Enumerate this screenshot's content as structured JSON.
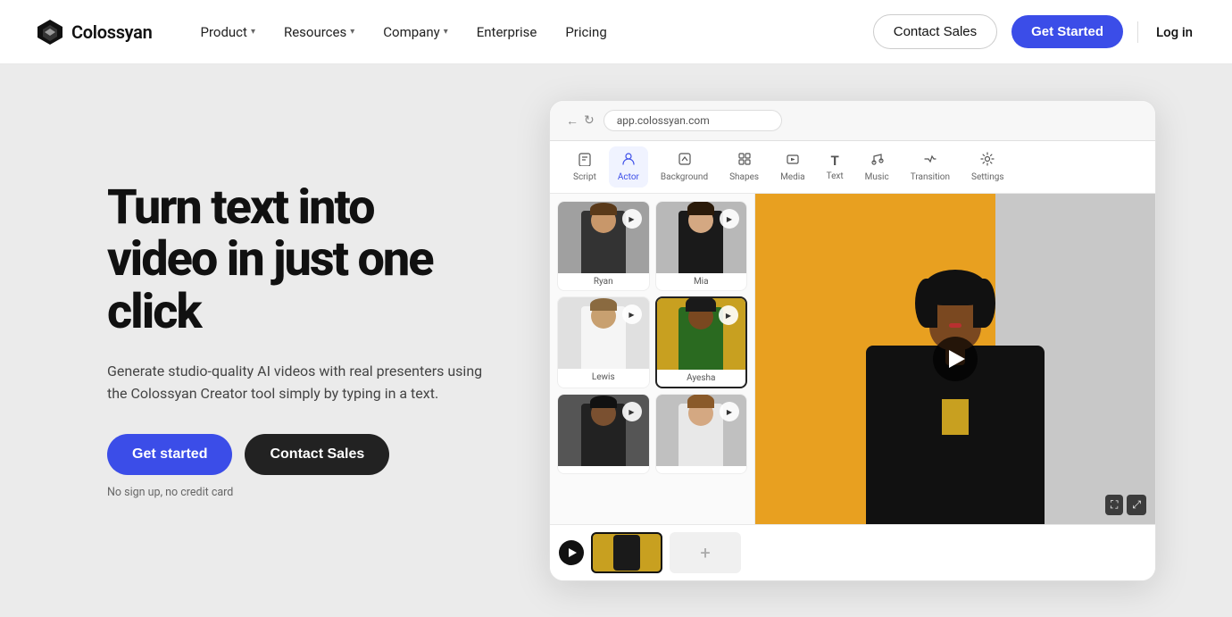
{
  "nav": {
    "logo_text": "Colossyan",
    "items": [
      {
        "label": "Product",
        "has_dropdown": true
      },
      {
        "label": "Resources",
        "has_dropdown": true
      },
      {
        "label": "Company",
        "has_dropdown": true
      },
      {
        "label": "Enterprise",
        "has_dropdown": false
      },
      {
        "label": "Pricing",
        "has_dropdown": false
      }
    ],
    "contact_sales": "Contact Sales",
    "get_started": "Get Started",
    "login": "Log in"
  },
  "hero": {
    "title": "Turn text into video in just one click",
    "description": "Generate studio-quality AI videos with real presenters using the Colossyan Creator tool simply by typing in a text.",
    "btn_start": "Get started",
    "btn_contact": "Contact Sales",
    "note": "No sign up, no credit card"
  },
  "app_preview": {
    "address": "app.colossyan.com",
    "toolbar": [
      {
        "icon": "📄",
        "label": "Script"
      },
      {
        "icon": "👤",
        "label": "Actor",
        "active": true
      },
      {
        "icon": "🖼",
        "label": "Background"
      },
      {
        "icon": "⬡",
        "label": "Shapes"
      },
      {
        "icon": "🎞",
        "label": "Media"
      },
      {
        "icon": "T",
        "label": "Text"
      },
      {
        "icon": "♪",
        "label": "Music"
      },
      {
        "icon": "✦",
        "label": "Transition"
      },
      {
        "icon": "⚙",
        "label": "Settings"
      }
    ],
    "actors": [
      {
        "name": "Ryan",
        "bg": "#b0b0b0"
      },
      {
        "name": "Mia",
        "bg": "#c0c0c0"
      },
      {
        "name": "Lewis",
        "bg": "#e0e0e0"
      },
      {
        "name": "Ayesha",
        "bg": "#c8a820",
        "selected": true
      },
      {
        "name": "",
        "bg": "#555"
      },
      {
        "name": "",
        "bg": "#d0d0d0"
      }
    ],
    "timeline": {
      "play_label": "▶",
      "add_label": "+"
    }
  },
  "colors": {
    "accent_blue": "#3b4de8",
    "dark": "#111111",
    "yellow": "#e8a020"
  }
}
